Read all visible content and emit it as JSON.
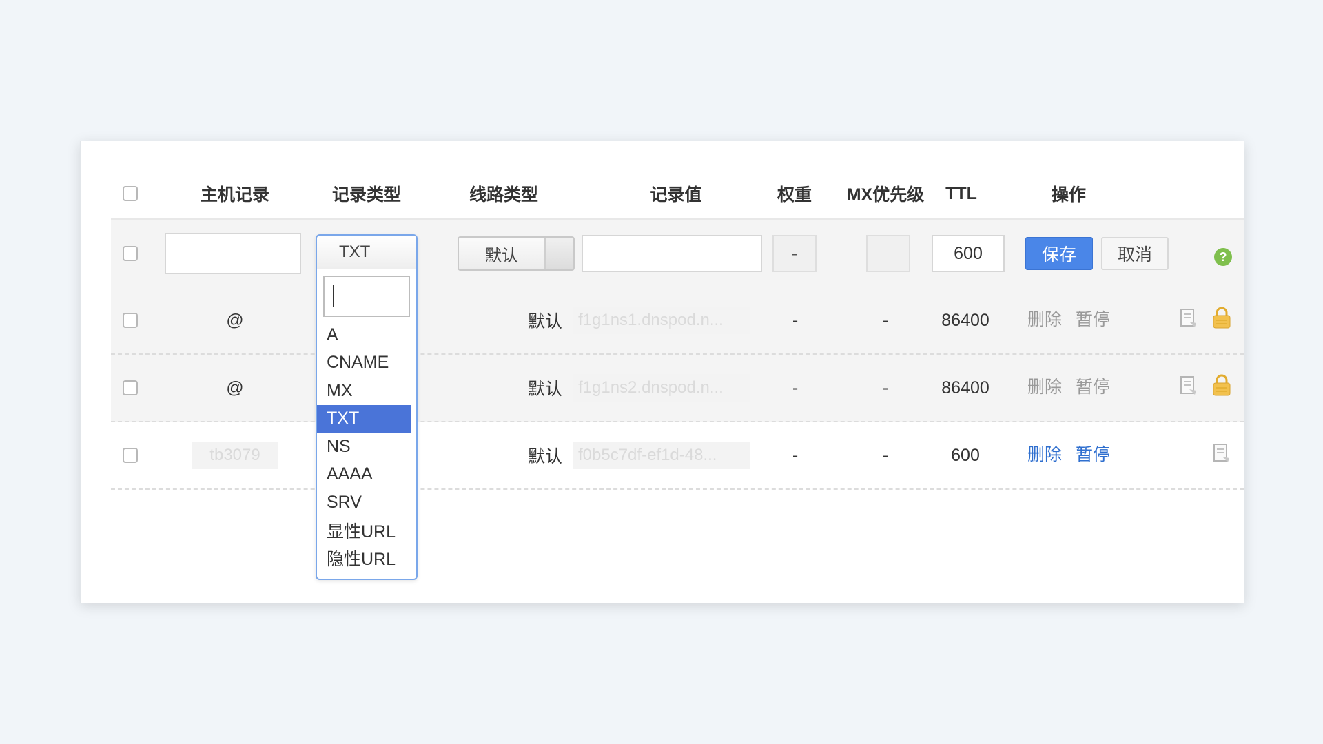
{
  "header": {
    "host": "主机记录",
    "type": "记录类型",
    "line": "线路类型",
    "value": "记录值",
    "weight": "权重",
    "mx": "MX优先级",
    "ttl": "TTL",
    "ops": "操作"
  },
  "edit_row": {
    "host_value": "",
    "type_selected": "TXT",
    "line_selected": "默认",
    "value_value": "",
    "weight": "-",
    "mx": "",
    "ttl": "600",
    "save_label": "保存",
    "cancel_label": "取消",
    "help_icon": "?"
  },
  "dropdown": {
    "search_value": "",
    "options": [
      "A",
      "CNAME",
      "MX",
      "TXT",
      "NS",
      "AAAA",
      "SRV",
      "显性URL",
      "隐性URL"
    ],
    "selected": "TXT"
  },
  "rows": [
    {
      "host": "@",
      "line": "默认",
      "value": "f1g1ns1.dnspod.n...",
      "weight": "-",
      "mx": "-",
      "ttl": "86400",
      "delete": "删除",
      "pause": "暂停",
      "locked": true
    },
    {
      "host": "@",
      "line": "默认",
      "value": "f1g1ns2.dnspod.n...",
      "weight": "-",
      "mx": "-",
      "ttl": "86400",
      "delete": "删除",
      "pause": "暂停",
      "locked": true
    },
    {
      "host": "tb3079",
      "line": "默认",
      "value": "f0b5c7df-ef1d-48...",
      "weight": "-",
      "mx": "-",
      "ttl": "600",
      "delete": "删除",
      "pause": "暂停",
      "locked": false
    }
  ],
  "colors": {
    "accent": "#4a86e8",
    "link_active": "#2f6fcf",
    "link_disabled": "#999999",
    "lock": "#f2c14e",
    "help": "#7fbf4d"
  }
}
